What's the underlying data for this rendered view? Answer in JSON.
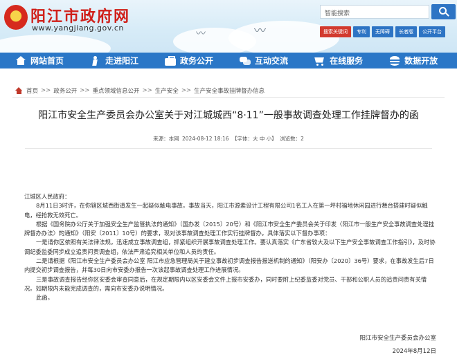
{
  "header": {
    "site_title": "阳江市政府网",
    "site_url": "www.yangjiang.gov.cn",
    "search_placeholder": "智能搜索",
    "quick_links": [
      "搜索关键词",
      "专利",
      "无障碍",
      "长者版",
      "公开平台"
    ]
  },
  "nav": [
    {
      "label": "网站首页",
      "icon": "home-icon"
    },
    {
      "label": "走进阳江",
      "icon": "walker-icon"
    },
    {
      "label": "政务公开",
      "icon": "briefcase-icon"
    },
    {
      "label": "互动交流",
      "icon": "chat-icon"
    },
    {
      "label": "在线服务",
      "icon": "cart-icon"
    },
    {
      "label": "数据开放",
      "icon": "database-icon"
    }
  ],
  "breadcrumb": [
    "首页",
    "政务公开",
    "重点领域信息公开",
    "生产安全",
    "生产安全事故挂牌督办信息"
  ],
  "article": {
    "title": "阳江市安全生产委员会办公室关于对江城城西“8·11”一般事故调查处理工作挂牌督办的函",
    "source_label": "来源：本网",
    "date": "2024-08-12 18:16",
    "font_size_label": "【字体：大 中 小】",
    "views_label": "浏览数：2",
    "paragraphs": [
      "江城区人民政府：",
      "8月11日3时许，在你辖区城西街道发生一起疑似触电事故。事故当天，阳江市源素设计工程有限公司1名工人在第一坪村福地休闲园进行舞台搭建时疑似触电，经抢救无效死亡。",
      "根据《国务院办公厅关于加强安全生产监管执法的通知》（国办发〔2015〕20号）和《阳江市安全生产委员会关于印发〈阳江市一般生产安全事故调查处理挂牌督办办法〉的通知》（阳安〔2011〕10号）的要求，现对该事故调查处理工作实行挂牌督办，具体落实以下督办事项：",
      "一是请你区依照有关法律法规，迅速成立事故调查组，抓紧组织开展事故调查处理工作。要认真落实《广东省较大及以下生产安全事故调查工作指引》，及时协调纪委监委同步成立追责问责调查组，依法严肃追究相关单位和人员的责任。",
      "二是请根据《阳江市安全生产委员会办公室 阳江市应急管理局关于建立事故初步调查报告报送机制的通知》（阳安办〔2020〕36号）要求，在事故发生后7日内提交初步调查报告，并每30日向市安委办报告一次该起事故调查处理工作进展情况。",
      "三是事故调查报告经你区安委会审查同意后，在规定期限内以区安委会文件上报市安委办，同时要附上纪委监委对党员、干部和公职人员的追责问责有关情况。如期限内未能完成调查的，需向市安委办说明情况。",
      "此函。"
    ],
    "signature_org": "阳江市安全生产委员会办公室",
    "signature_date": "2024年8月12日"
  },
  "colors": {
    "brand_red": "#d0201a",
    "nav_blue": "#2b77c7",
    "header_bg": "#d6ebf7"
  }
}
